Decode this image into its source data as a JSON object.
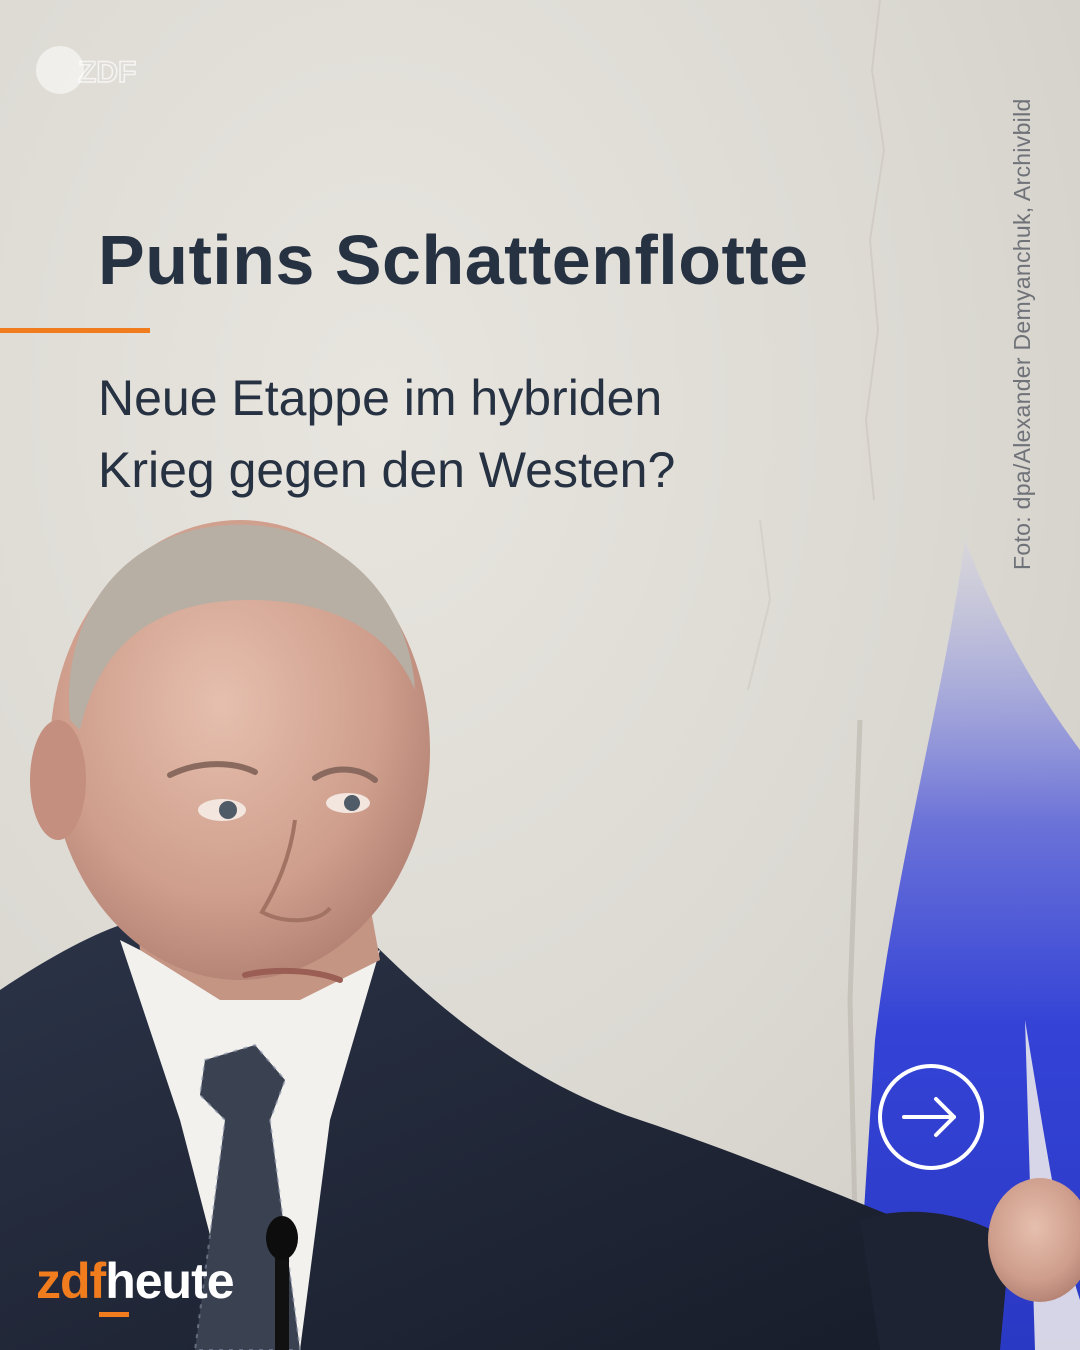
{
  "post": {
    "title": "Putins Schattenflotte",
    "subtitle_lines": [
      "Neue Etappe im hybriden",
      "Krieg gegen den Westen?"
    ],
    "photo_credit": "Foto: dpa/Alexander Demyanchuk, Archivbild"
  },
  "branding": {
    "watermark_text": "ZDF",
    "logo_part1": "zdf",
    "logo_part2": "heute"
  },
  "navigation": {
    "next_icon": "arrow-right-circle-icon"
  },
  "colors": {
    "accent": "#f07c1e",
    "text": "#263142",
    "background": "#dcd9d3",
    "flag_blue": "#2f3fd0"
  }
}
